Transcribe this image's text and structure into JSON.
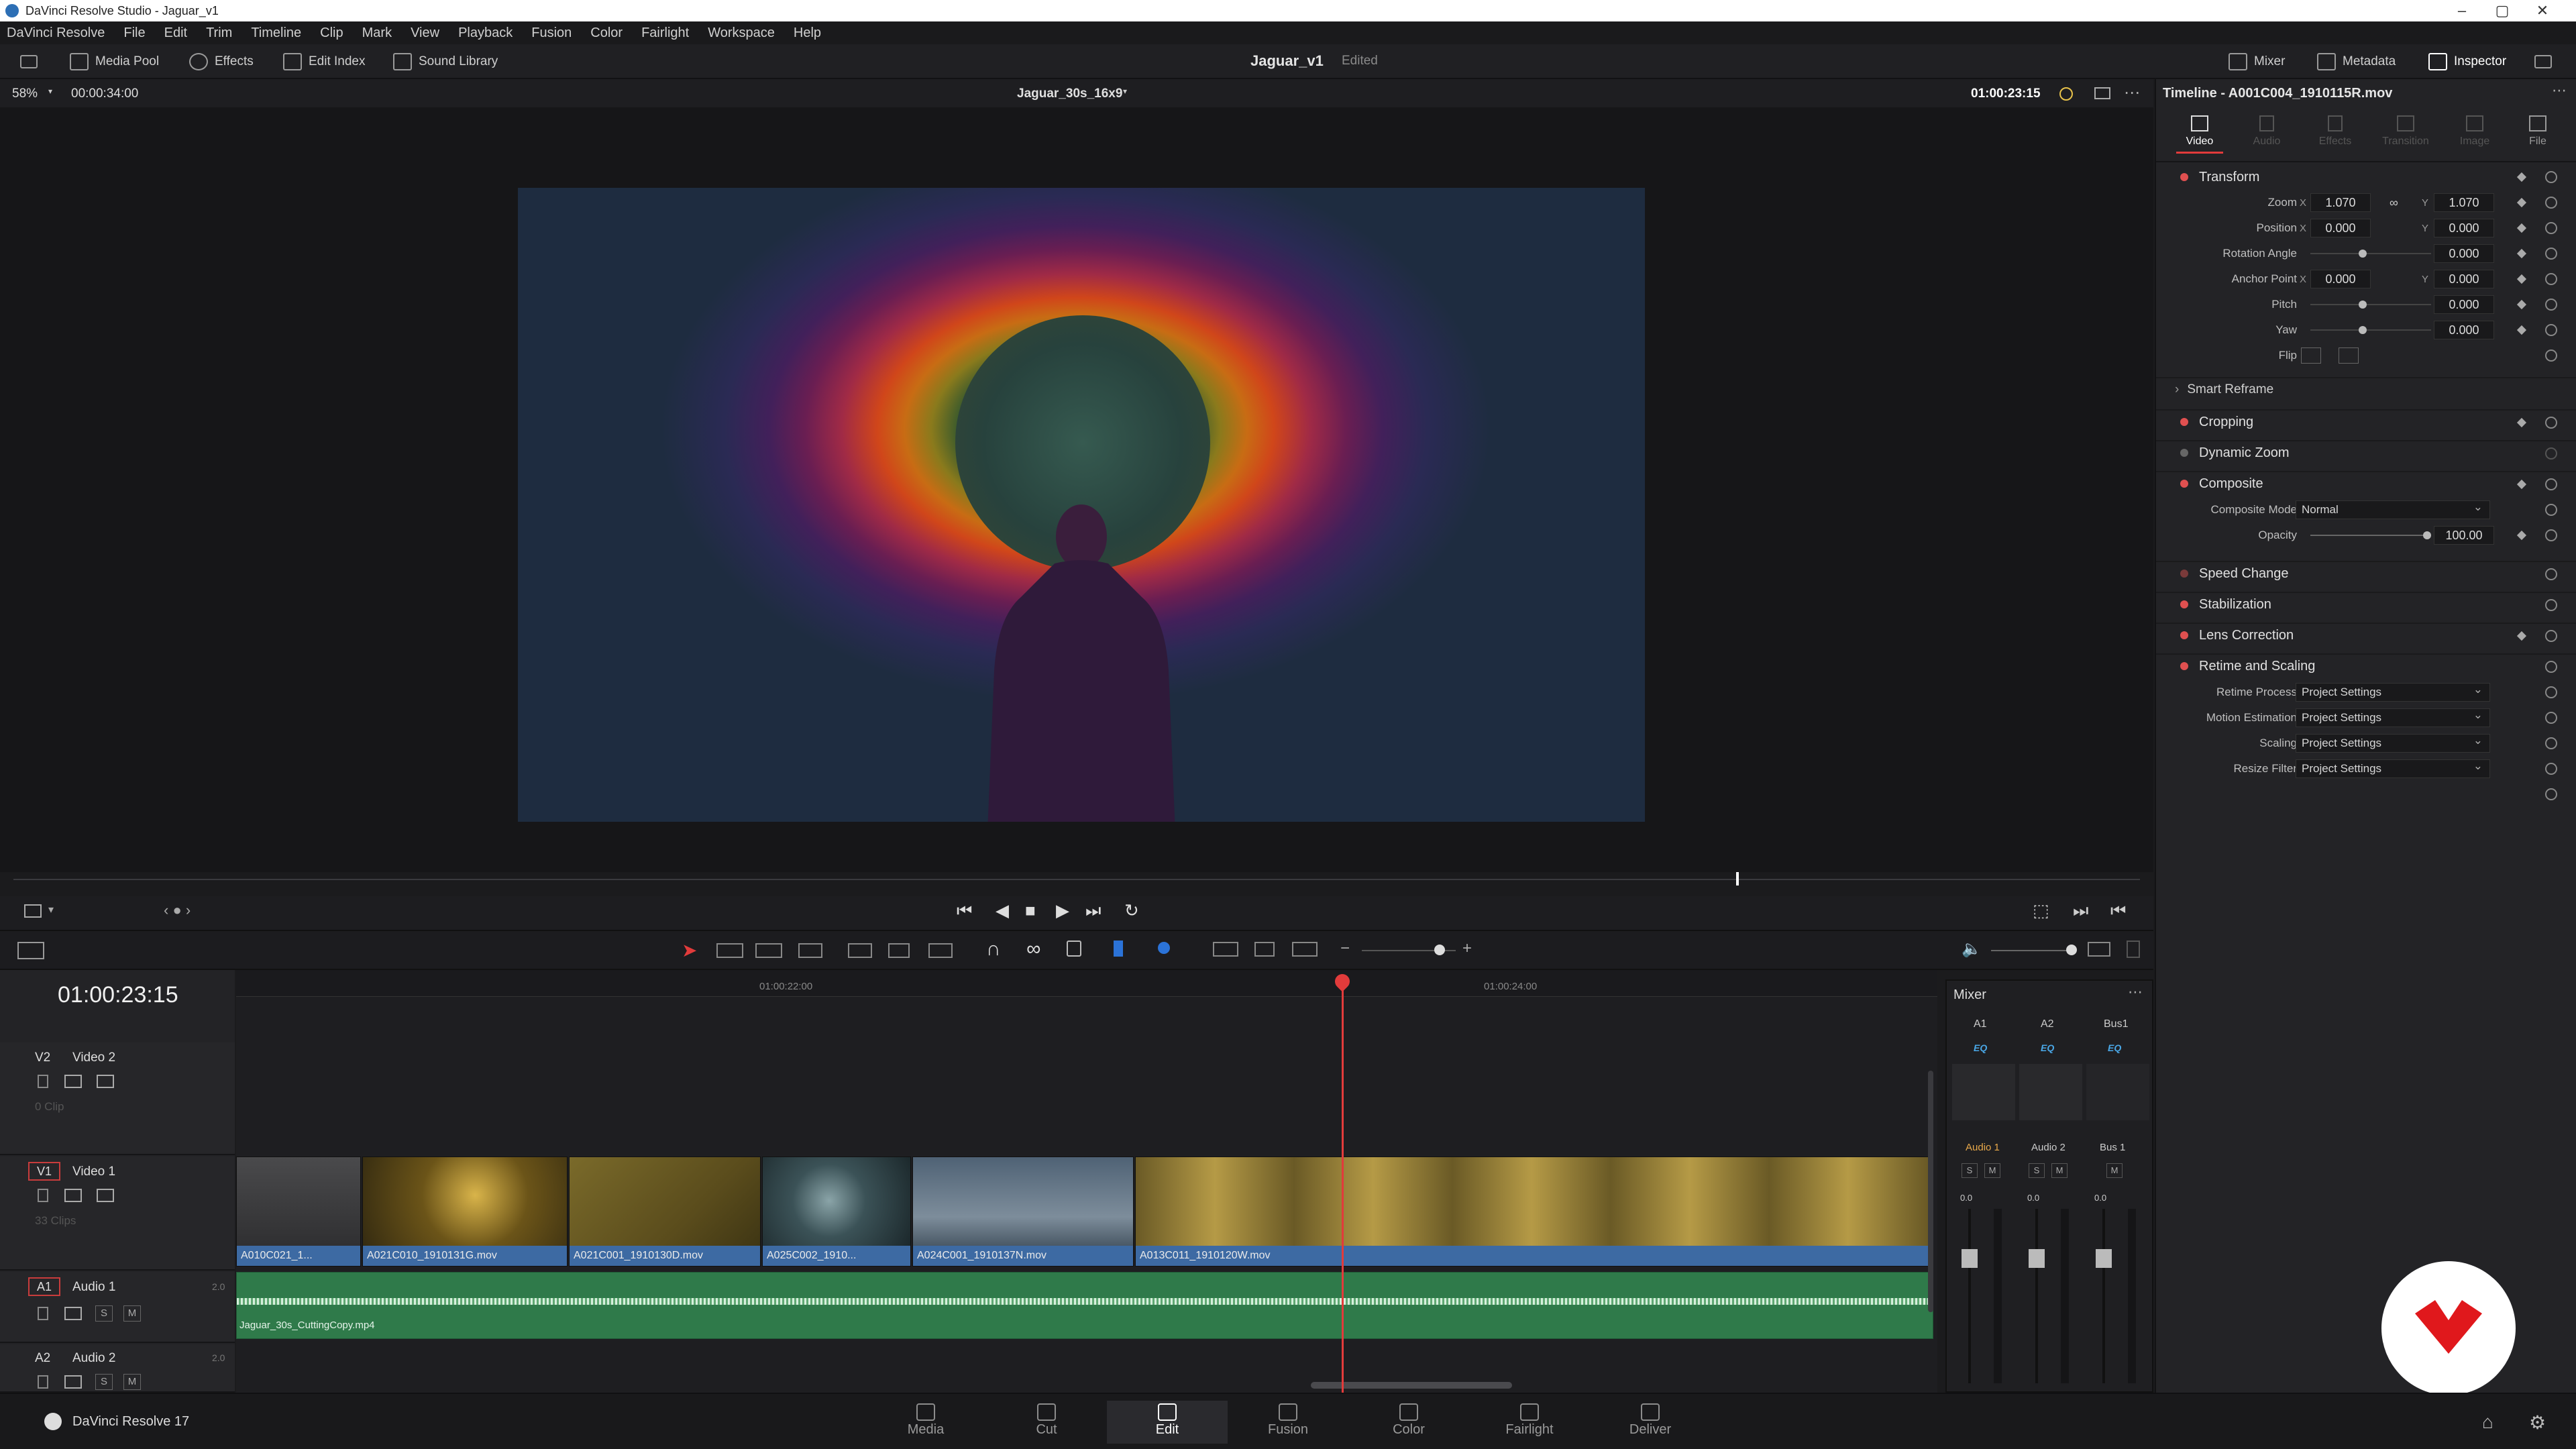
{
  "window": {
    "title": "DaVinci Resolve Studio - Jaguar_v1"
  },
  "menu": [
    "DaVinci Resolve",
    "File",
    "Edit",
    "Trim",
    "Timeline",
    "Clip",
    "Mark",
    "View",
    "Playback",
    "Fusion",
    "Color",
    "Fairlight",
    "Workspace",
    "Help"
  ],
  "toolbar": {
    "media_pool": "Media Pool",
    "effects": "Effects",
    "edit_index": "Edit Index",
    "sound_library": "Sound Library",
    "project_name": "Jaguar_v1",
    "project_status": "Edited",
    "mixer": "Mixer",
    "metadata": "Metadata",
    "inspector": "Inspector"
  },
  "viewer": {
    "zoom": "58%",
    "duration": "00:00:34:00",
    "timeline_name": "Jaguar_30s_16x9",
    "timecode": "01:00:23:15"
  },
  "timeline": {
    "timecode": "01:00:23:15",
    "ruler_marks": [
      "01:00:22:00",
      "01:00:24:00"
    ],
    "tracks": [
      {
        "id": "V2",
        "name": "Video 2",
        "info": "0 Clip"
      },
      {
        "id": "V1",
        "name": "Video 1",
        "info": "33 Clips"
      },
      {
        "id": "A1",
        "name": "Audio 1",
        "channels": "2.0"
      },
      {
        "id": "A2",
        "name": "Audio 2",
        "channels": "2.0"
      }
    ],
    "video_clips": [
      {
        "name": "A010C021_1..."
      },
      {
        "name": "A021C010_1910131G.mov"
      },
      {
        "name": "A021C001_1910130D.mov"
      },
      {
        "name": "A025C002_1910..."
      },
      {
        "name": "A024C001_1910137N.mov"
      },
      {
        "name": "A013C011_1910120W.mov"
      }
    ],
    "audio_clip": "Jaguar_30s_CuttingCopy.mp4"
  },
  "mixer": {
    "title": "Mixer",
    "channels": [
      "A1",
      "A2",
      "Bus1"
    ],
    "eq": "EQ",
    "strip_names": [
      "Audio 1",
      "Audio 2",
      "Bus 1"
    ],
    "solo": "S",
    "mute": "M",
    "level": "0.0"
  },
  "inspector": {
    "title": "Timeline - A001C004_1910115R.mov",
    "tabs": [
      "Video",
      "Audio",
      "Effects",
      "Transition",
      "Image",
      "File"
    ],
    "transform": {
      "label": "Transform",
      "zoom_label": "Zoom",
      "zoom_x": "1.070",
      "zoom_y": "1.070",
      "position_label": "Position",
      "position_x": "0.000",
      "position_y": "0.000",
      "rotation_label": "Rotation Angle",
      "rotation": "0.000",
      "anchor_label": "Anchor Point",
      "anchor_x": "0.000",
      "anchor_y": "0.000",
      "pitch_label": "Pitch",
      "pitch": "0.000",
      "yaw_label": "Yaw",
      "yaw": "0.000",
      "flip_label": "Flip",
      "x": "X",
      "y": "Y"
    },
    "smart_reframe": "Smart Reframe",
    "cropping": "Cropping",
    "dynamic_zoom": "Dynamic Zoom",
    "composite": {
      "label": "Composite",
      "mode_label": "Composite Mode",
      "mode": "Normal",
      "opacity_label": "Opacity",
      "opacity": "100.00"
    },
    "speed_change": "Speed Change",
    "stabilization": "Stabilization",
    "lens_correction": "Lens Correction",
    "retime": {
      "label": "Retime and Scaling",
      "retime_process_label": "Retime Process",
      "retime_process": "Project Settings",
      "motion_estimation_label": "Motion Estimation",
      "motion_estimation": "Project Settings",
      "scaling_label": "Scaling",
      "scaling": "Project Settings",
      "resize_filter_label": "Resize Filter",
      "resize_filter": "Project Settings"
    }
  },
  "pages": [
    "Media",
    "Cut",
    "Edit",
    "Fusion",
    "Color",
    "Fairlight",
    "Deliver"
  ],
  "active_page": "Edit",
  "app_label": "DaVinci Resolve 17",
  "colors": {
    "accent_red": "#e23b3b",
    "clip_blue": "#3d6aa3",
    "audio_green": "#2f7a4a"
  }
}
